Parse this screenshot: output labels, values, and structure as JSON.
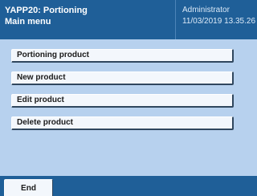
{
  "header": {
    "app_title": "YAPP20: Portioning",
    "screen_title": "Main menu",
    "user": "Administrator",
    "datetime": "11/03/2019 13.35.26"
  },
  "menu": {
    "items": [
      {
        "label": "Portioning product"
      },
      {
        "label": "New product"
      },
      {
        "label": "Edit product"
      },
      {
        "label": "Delete product"
      }
    ]
  },
  "footer": {
    "end_label": "End"
  },
  "colors": {
    "header_bg": "#1f5f98",
    "content_bg": "#b7d1ee",
    "button_bg": "#f3f7fc"
  }
}
